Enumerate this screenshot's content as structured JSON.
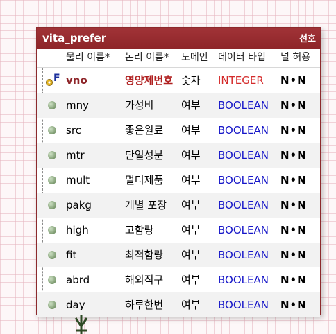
{
  "entity": {
    "name": "vita_prefer",
    "badge": "선호",
    "columns": {
      "physical": "물리 이름*",
      "logical": "논리 이름*",
      "domain": "도메인",
      "datatype": "데이터 타입",
      "nullable": "널 허용"
    },
    "rows": [
      {
        "physical": "vno",
        "logical": "영양제번호",
        "domain": "숫자",
        "datatype": "INTEGER",
        "nullable": "N•N",
        "pk": true
      },
      {
        "physical": "mny",
        "logical": "가성비",
        "domain": "여부",
        "datatype": "BOOLEAN",
        "nullable": "N•N",
        "pk": false
      },
      {
        "physical": "src",
        "logical": "좋은원료",
        "domain": "여부",
        "datatype": "BOOLEAN",
        "nullable": "N•N",
        "pk": false
      },
      {
        "physical": "mtr",
        "logical": "단일성분",
        "domain": "여부",
        "datatype": "BOOLEAN",
        "nullable": "N•N",
        "pk": false
      },
      {
        "physical": "mult",
        "logical": "멀티제품",
        "domain": "여부",
        "datatype": "BOOLEAN",
        "nullable": "N•N",
        "pk": false
      },
      {
        "physical": "pakg",
        "logical": "개별 포장",
        "domain": "여부",
        "datatype": "BOOLEAN",
        "nullable": "N•N",
        "pk": false
      },
      {
        "physical": "high",
        "logical": "고함량",
        "domain": "여부",
        "datatype": "BOOLEAN",
        "nullable": "N•N",
        "pk": false
      },
      {
        "physical": "fit",
        "logical": "최적함량",
        "domain": "여부",
        "datatype": "BOOLEAN",
        "nullable": "N•N",
        "pk": false
      },
      {
        "physical": "abrd",
        "logical": "해외직구",
        "domain": "여부",
        "datatype": "BOOLEAN",
        "nullable": "N•N",
        "pk": false
      },
      {
        "physical": "day",
        "logical": "하루한번",
        "domain": "여부",
        "datatype": "BOOLEAN",
        "nullable": "N•N",
        "pk": false
      }
    ]
  },
  "colors": {
    "title_bg": "#8e2529",
    "integer_type": "#d42b2b",
    "boolean_type": "#1515c8",
    "pk_name": "#8e2529"
  },
  "icons": {
    "primary_key": "pk-key-icon",
    "column": "column-dot-icon",
    "relationship": "crows-foot-connector-icon"
  }
}
